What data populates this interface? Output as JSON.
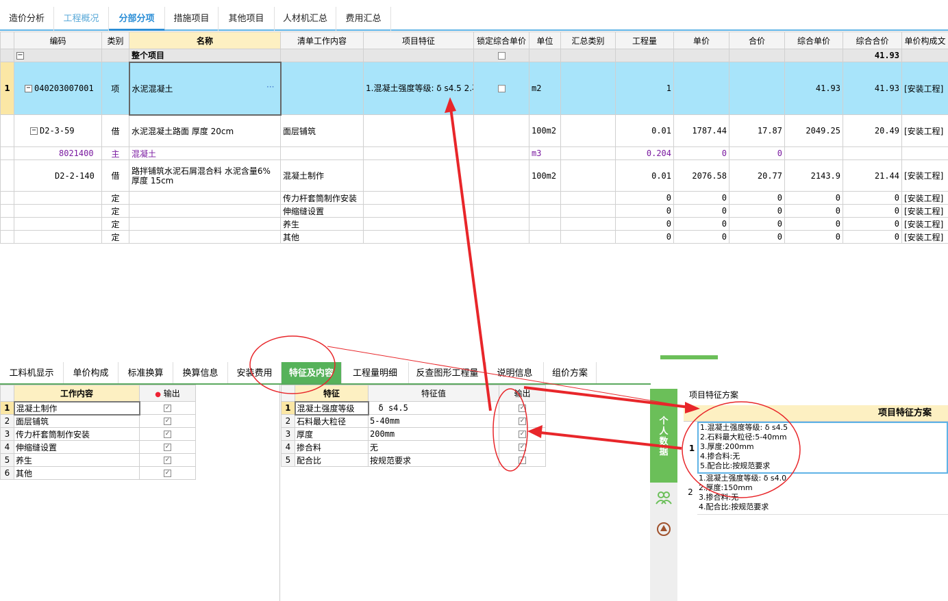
{
  "top_tabs": [
    "造价分析",
    "工程概况",
    "分部分项",
    "措施项目",
    "其他项目",
    "人材机汇总",
    "费用汇总"
  ],
  "main_headers": [
    "编码",
    "类别",
    "名称",
    "清单工作内容",
    "项目特征",
    "锁定综合单价",
    "单位",
    "汇总类别",
    "工程量",
    "单价",
    "合价",
    "综合单价",
    "综合合价",
    "单价构成文"
  ],
  "total_row": {
    "label": "整个项目",
    "total": "41.93"
  },
  "rows": [
    {
      "idx": "1",
      "code": "040203007001",
      "type": "项",
      "name": "水泥混凝土",
      "content": "",
      "feature": "1.混凝土强度等级:  δ s4.5\n2.石料最大粒径:5-40mm\n3.厚度:200mm\n4.掺合料:无\n5.配合比:按规范要求",
      "unit": "m2",
      "qty": "1",
      "price": "",
      "amount": "",
      "cunit": "41.93",
      "ctotal": "41.93",
      "comp": "[安装工程]"
    },
    {
      "idx": "",
      "code": "D2-3-59",
      "type": "借",
      "name": "水泥混凝土路面 厚度 20cm",
      "content": "面层铺筑",
      "feature": "",
      "unit": "100m2",
      "qty": "0.01",
      "price": "1787.44",
      "amount": "17.87",
      "cunit": "2049.25",
      "ctotal": "20.49",
      "comp": "[安装工程]"
    },
    {
      "idx": "",
      "code": "8021400",
      "type": "主",
      "name": "混凝土",
      "content": "",
      "feature": "",
      "unit": "m3",
      "qty": "0.204",
      "price": "0",
      "amount": "0",
      "cunit": "",
      "ctotal": "",
      "comp": ""
    },
    {
      "idx": "",
      "code": "D2-2-140",
      "type": "借",
      "name": "路拌铺筑水泥石屑混合料 水泥含量6% 厚度 15cm",
      "content": "混凝土制作",
      "feature": "",
      "unit": "100m2",
      "qty": "0.01",
      "price": "2076.58",
      "amount": "20.77",
      "cunit": "2143.9",
      "ctotal": "21.44",
      "comp": "[安装工程]"
    },
    {
      "idx": "",
      "code": "",
      "type": "定",
      "name": "",
      "content": "传力杆套筒制作安装",
      "feature": "",
      "unit": "",
      "qty": "0",
      "price": "0",
      "amount": "0",
      "cunit": "0",
      "ctotal": "0",
      "comp": "[安装工程]"
    },
    {
      "idx": "",
      "code": "",
      "type": "定",
      "name": "",
      "content": "伸缩缝设置",
      "feature": "",
      "unit": "",
      "qty": "0",
      "price": "0",
      "amount": "0",
      "cunit": "0",
      "ctotal": "0",
      "comp": "[安装工程]"
    },
    {
      "idx": "",
      "code": "",
      "type": "定",
      "name": "",
      "content": "养生",
      "feature": "",
      "unit": "",
      "qty": "0",
      "price": "0",
      "amount": "0",
      "cunit": "0",
      "ctotal": "0",
      "comp": "[安装工程]"
    },
    {
      "idx": "",
      "code": "",
      "type": "定",
      "name": "",
      "content": "其他",
      "feature": "",
      "unit": "",
      "qty": "0",
      "price": "0",
      "amount": "0",
      "cunit": "0",
      "ctotal": "0",
      "comp": "[安装工程]"
    }
  ],
  "bottom_tabs": [
    "工料机显示",
    "单价构成",
    "标准换算",
    "换算信息",
    "安装费用",
    "特征及内容",
    "工程量明细",
    "反查图形工程量",
    "说明信息",
    "组价方案"
  ],
  "work": {
    "h1": "工作内容",
    "h2": "输出",
    "items": [
      "混凝土制作",
      "面层铺筑",
      "传力杆套筒制作安装",
      "伸缩缝设置",
      "养生",
      "其他"
    ]
  },
  "feat": {
    "h1": "特征",
    "h2": "特征值",
    "h3": "输出",
    "items": [
      [
        "混凝土强度等级",
        "δ s4.5"
      ],
      [
        "石料最大粒径",
        "5-40mm"
      ],
      [
        "厚度",
        "200mm"
      ],
      [
        "掺合料",
        "无"
      ],
      [
        "配合比",
        "按规范要求"
      ]
    ]
  },
  "side": {
    "label": "个人数据"
  },
  "scheme": {
    "title": "项目特征方案",
    "head": "项目特征方案",
    "items": [
      {
        "idx": "1",
        "text": "1.混凝土强度等级:  δ s4.5\n2.石料最大粒径:5-40mm\n3.厚度:200mm\n4.掺合料:无\n5.配合比:按规范要求"
      },
      {
        "idx": "2",
        "text": "1.混凝土强度等级:  δ s4.0\n2.厚度:150mm\n3.掺合料:无\n4.配合比:按规范要求"
      }
    ]
  },
  "colors": {
    "accent": "#2b8ed6",
    "green": "#56b25a",
    "selected": "#a8e4fa",
    "annot": "#e8262a"
  }
}
